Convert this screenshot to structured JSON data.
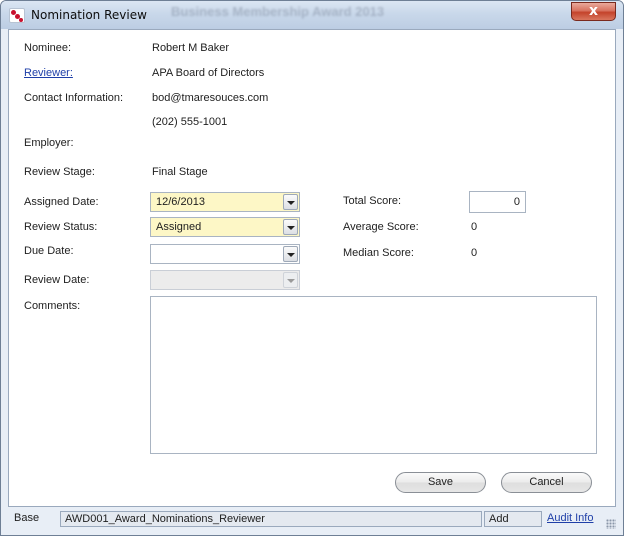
{
  "window": {
    "title": "Nomination Review",
    "close_glyph": "x",
    "background_title_text": "Business Membership Award 2013"
  },
  "form": {
    "nominee": {
      "label": "Nominee:",
      "value": "Robert M Baker"
    },
    "reviewer": {
      "label": "Reviewer:",
      "value": "APA Board of Directors"
    },
    "contact": {
      "label": "Contact Information:",
      "email": "bod@tmaresouces.com",
      "phone": "(202) 555-1001"
    },
    "employer": {
      "label": "Employer:",
      "value": ""
    },
    "review_stage": {
      "label": "Review Stage:",
      "value": "Final Stage"
    },
    "assigned_date": {
      "label": "Assigned Date:",
      "value": "12/6/2013"
    },
    "review_status": {
      "label": "Review Status:",
      "value": "Assigned"
    },
    "due_date": {
      "label": "Due Date:",
      "value": ""
    },
    "review_date": {
      "label": "Review Date:",
      "value": ""
    },
    "comments": {
      "label": "Comments:",
      "value": ""
    },
    "total_score": {
      "label": "Total Score:",
      "value": "0"
    },
    "average_score": {
      "label": "Average Score:",
      "value": "0"
    },
    "median_score": {
      "label": "Median Score:",
      "value": "0"
    }
  },
  "buttons": {
    "save": "Save",
    "cancel": "Cancel"
  },
  "statusbar": {
    "base": "Base",
    "form_name": "AWD001_Award_Nominations_Reviewer",
    "mode": "Add",
    "audit": "Audit Info"
  },
  "colors": {
    "required_field": "#fdf7c6",
    "link": "#1f3fa8",
    "close_button": "#c4432b"
  },
  "icons": {
    "app": "nomination-app-icon",
    "dropdown": "chevron-down-icon",
    "close": "close-icon",
    "grip": "resize-grip-icon"
  }
}
